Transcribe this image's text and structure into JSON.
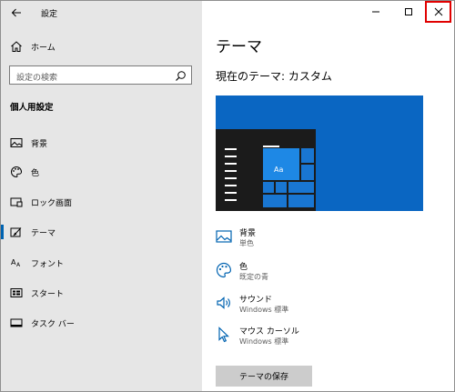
{
  "titlebar": {
    "app_title": "設定"
  },
  "sidebar": {
    "home_label": "ホーム",
    "search_placeholder": "設定の検索",
    "section_title": "個人用設定",
    "items": [
      {
        "label": "背景",
        "icon": "picture-icon"
      },
      {
        "label": "色",
        "icon": "palette-icon"
      },
      {
        "label": "ロック画面",
        "icon": "lock-screen-icon"
      },
      {
        "label": "テーマ",
        "icon": "theme-brush-icon",
        "selected": true
      },
      {
        "label": "フォント",
        "icon": "font-icon"
      },
      {
        "label": "スタート",
        "icon": "start-grid-icon"
      },
      {
        "label": "タスク バー",
        "icon": "taskbar-icon"
      }
    ]
  },
  "main": {
    "page_title": "テーマ",
    "current_theme": "現在のテーマ: カスタム",
    "preview_tile_label": "Aa",
    "settings": [
      {
        "name": "背景",
        "sub": "単色",
        "icon": "picture-icon"
      },
      {
        "name": "色",
        "sub": "既定の青",
        "icon": "palette-icon"
      },
      {
        "name": "サウンド",
        "sub": "Windows 標準",
        "icon": "speaker-icon"
      },
      {
        "name": "マウス カーソル",
        "sub": "Windows 標準",
        "icon": "cursor-icon"
      }
    ],
    "save_button": "テーマの保存"
  },
  "colors": {
    "accent": "#0063b1",
    "preview_blue": "#0a66c2",
    "close_highlight": "#e00000",
    "sidebar_bg": "#e6e6e6"
  }
}
